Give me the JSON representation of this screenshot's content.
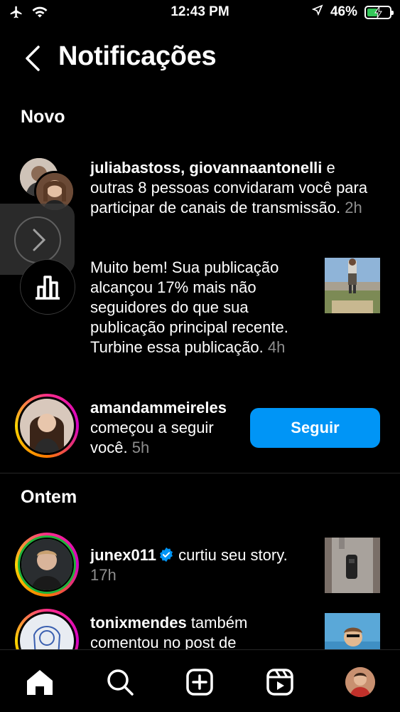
{
  "status": {
    "time": "12:43 PM",
    "battery": "46%",
    "battery_level": 0.46
  },
  "header": {
    "title": "Notificações"
  },
  "sections": {
    "new_title": "Novo",
    "yesterday_title": "Ontem"
  },
  "notifications": [
    {
      "users": "juliabastoss, giovannaantonelli",
      "text": " e outras 8 pessoas convidaram você para participar de canais de transmissão.",
      "time": "2h"
    },
    {
      "text": "Muito bem! Sua publicação alcançou 17% mais não seguidores do que sua publicação principal recente. Turbine essa publicação.",
      "time": "4h"
    },
    {
      "user": "amandammeireles",
      "text": " começou a seguir você.",
      "time": "5h",
      "button": "Seguir"
    },
    {
      "user": "junex011",
      "text": " curtiu seu story.",
      "time": "17h"
    },
    {
      "user": "tonixmendes",
      "text": " também comentou no post de"
    }
  ],
  "tabs": [
    "home-icon",
    "search-icon",
    "create-icon",
    "reels-icon",
    "profile-avatar"
  ],
  "colors": {
    "accent": "#0095f6",
    "background": "#000000",
    "secondary_text": "#8e8e8e"
  }
}
